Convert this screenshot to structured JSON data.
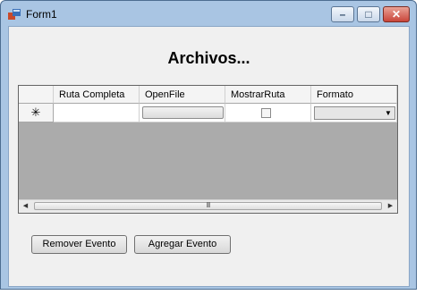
{
  "window": {
    "title": "Form1",
    "icons": {
      "app": "app-form-icon",
      "minimize": "minimize-icon",
      "maximize": "maximize-icon",
      "close": "close-icon"
    },
    "glyphs": {
      "minimize": "–",
      "maximize": "□",
      "close": "✕"
    }
  },
  "heading": "Archivos...",
  "grid": {
    "columns": [
      "Ruta Completa",
      "OpenFile",
      "MostrarRuta",
      "Formato"
    ],
    "new_row_marker": "✳",
    "combo_arrow": "▼",
    "scroll_left": "◀",
    "scroll_right": "▶",
    "scroll_grip": "III"
  },
  "buttons": {
    "remove": "Remover Evento",
    "add": "Agregar Evento"
  },
  "colors": {
    "title_bar": "#a9c5e3",
    "client": "#f0f0f0",
    "grid_background": "#ababab",
    "close_button": "#c9453a"
  }
}
